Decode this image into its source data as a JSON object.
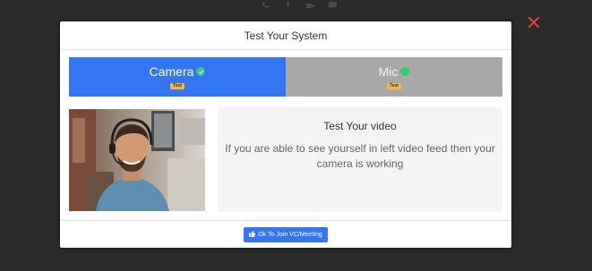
{
  "modal": {
    "title": "Test Your System"
  },
  "tabs": [
    {
      "label": "Camera",
      "badge": "Test",
      "status": "check-icon",
      "color": "#3475f3"
    },
    {
      "label": "Mic",
      "badge": "Test",
      "status": "dot-icon",
      "color": "#a9a7a7"
    }
  ],
  "info": {
    "title": "Test Your video",
    "text": "If you are able to see yourself in left video feed then your camera is working"
  },
  "footer": {
    "join_label": "Ok To Join VC/Meeting"
  },
  "colors": {
    "accent": "#3475f3",
    "close": "#e0453a",
    "badge": "#f5b73b",
    "success": "#2fc98a"
  }
}
